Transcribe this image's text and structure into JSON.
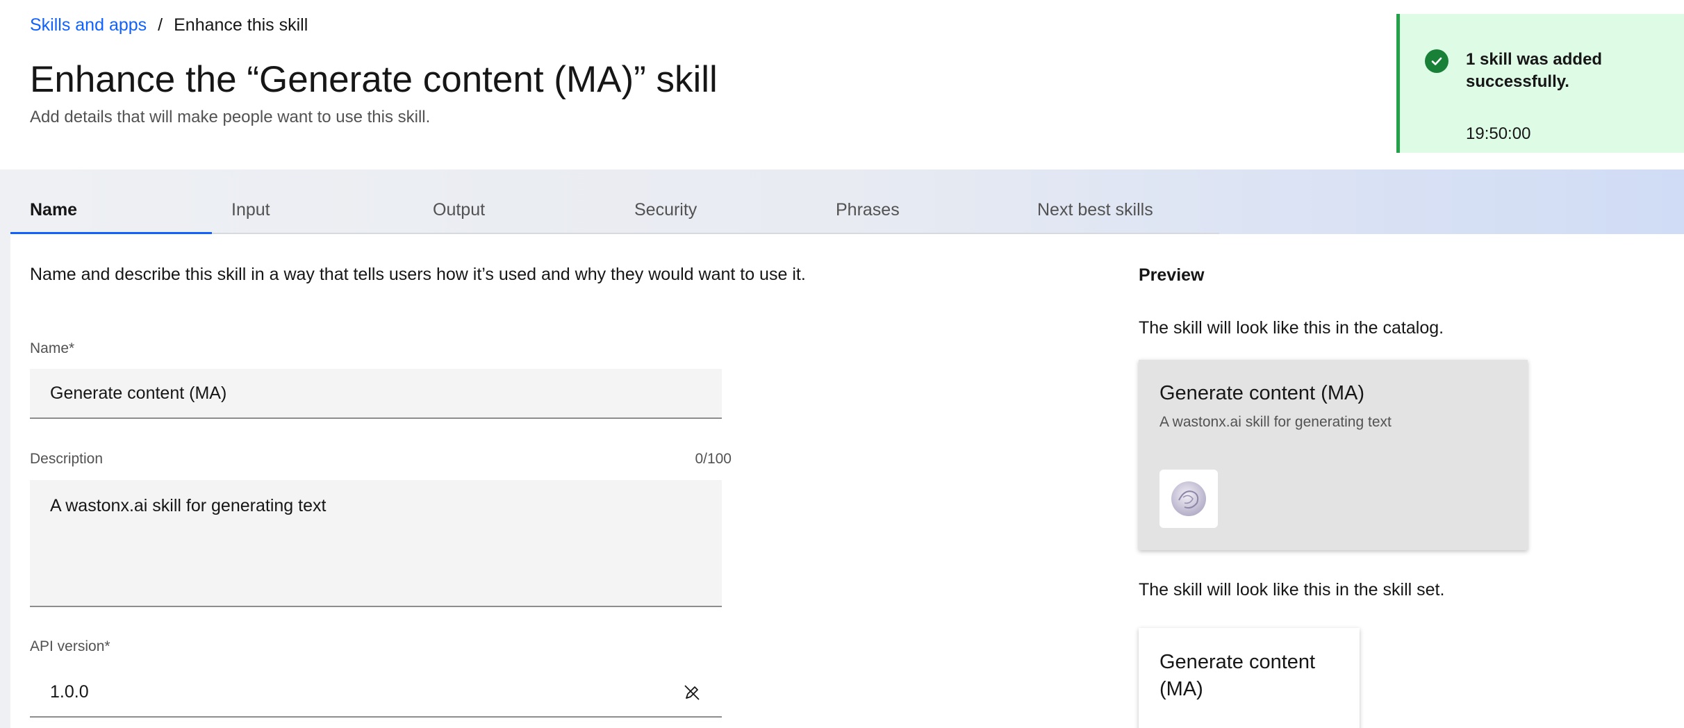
{
  "breadcrumb": {
    "parent": "Skills and apps",
    "separator": "/",
    "current": "Enhance this skill"
  },
  "header": {
    "title": "Enhance the “Generate content (MA)” skill",
    "subtitle": "Add details that will make people want to use this skill."
  },
  "toast": {
    "title": "1 skill was added successfully.",
    "time": "19:50:00",
    "status_color": "#24a148",
    "icon": "checkmark-filled-icon"
  },
  "tabs": [
    {
      "label": "Name",
      "active": true
    },
    {
      "label": "Input",
      "active": false
    },
    {
      "label": "Output",
      "active": false
    },
    {
      "label": "Security",
      "active": false
    },
    {
      "label": "Phrases",
      "active": false
    },
    {
      "label": "Next best skills",
      "active": false
    }
  ],
  "form": {
    "intro": "Name and describe this skill in a way that tells users how it’s used and why they would want to use it.",
    "name_label": "Name*",
    "name_value": "Generate content (MA)",
    "description_label": "Description",
    "description_counter": "0/100",
    "description_value": "A wastonx.ai skill for generating text",
    "api_label": "API version*",
    "api_value": "1.0.0",
    "api_edit_icon": "edit-off-icon"
  },
  "preview": {
    "title": "Preview",
    "catalog_text": "The skill will look like this in the catalog.",
    "catalog_card_title": "Generate content (MA)",
    "catalog_card_desc": "A wastonx.ai skill for generating text",
    "catalog_card_logo": "watsonx-logo-icon",
    "skillset_text": "The skill will look like this in the skill set.",
    "skillset_card_title": "Generate content (MA)"
  },
  "colors": {
    "accent": "#0f62fe",
    "success": "#24a148",
    "toast_bg": "#defbe6"
  }
}
